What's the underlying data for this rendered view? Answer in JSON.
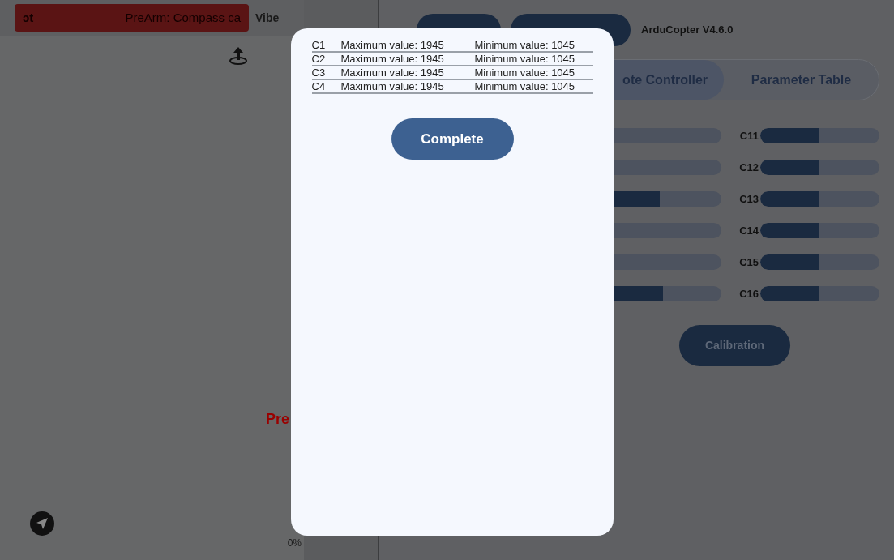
{
  "left_panel": {
    "alert": {
      "text_left": "ɔt",
      "text_right": "PreArm: Compass ca"
    },
    "vibe_label": "Vibe",
    "warning_text": "Pre",
    "progress_text": "0%"
  },
  "right_panel": {
    "connection_buttons": [
      {
        "kind": "dropdown"
      },
      {
        "kind": "plain"
      }
    ],
    "firmware": "ArduCopter V4.6.0",
    "tabs": [
      {
        "label": "ote Controller",
        "selected": true
      },
      {
        "label": "Parameter Table",
        "selected": false
      }
    ],
    "channels_left": [
      {
        "kind": "covered"
      },
      {
        "kind": "covered"
      },
      {
        "kind": "filled",
        "level": 0.48
      },
      {
        "kind": "covered"
      },
      {
        "kind": "covered"
      },
      {
        "kind": "filled",
        "level": 0.51
      }
    ],
    "channels_right": [
      {
        "label": "C11",
        "level": 0.49
      },
      {
        "label": "C12",
        "level": 0.49
      },
      {
        "label": "C13",
        "level": 0.49
      },
      {
        "label": "C14",
        "level": 0.49
      },
      {
        "label": "C15",
        "level": 0.49
      },
      {
        "label": "C16",
        "level": 0.49
      }
    ],
    "calibration_button": "Calibration"
  },
  "dialog": {
    "rows": [
      {
        "channel": "C1",
        "max": "Maximum value: 1945",
        "min": "Minimum value: 1045"
      },
      {
        "channel": "C2",
        "max": "Maximum value: 1945",
        "min": "Minimum value: 1045"
      },
      {
        "channel": "C3",
        "max": "Maximum value: 1945",
        "min": "Minimum value: 1045"
      },
      {
        "channel": "C4",
        "max": "Maximum value: 1945",
        "min": "Minimum value: 1045"
      }
    ],
    "complete_button": "Complete"
  }
}
